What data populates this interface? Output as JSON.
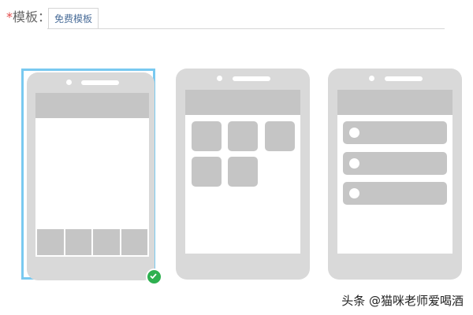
{
  "field": {
    "required_mark": "*",
    "label": "模板："
  },
  "tabs": [
    {
      "label": "免费模板"
    }
  ],
  "templates": [
    {
      "name": "tab-bar-layout",
      "selected": true
    },
    {
      "name": "grid-layout",
      "selected": false
    },
    {
      "name": "list-layout",
      "selected": false
    }
  ],
  "watermark": "头条 @猫咪老师爱喝酒",
  "colors": {
    "selected_border": "#79c9f0",
    "check_green": "#2eb050",
    "phone_gray": "#d9d9d9",
    "block_gray": "#c5c5c5"
  }
}
